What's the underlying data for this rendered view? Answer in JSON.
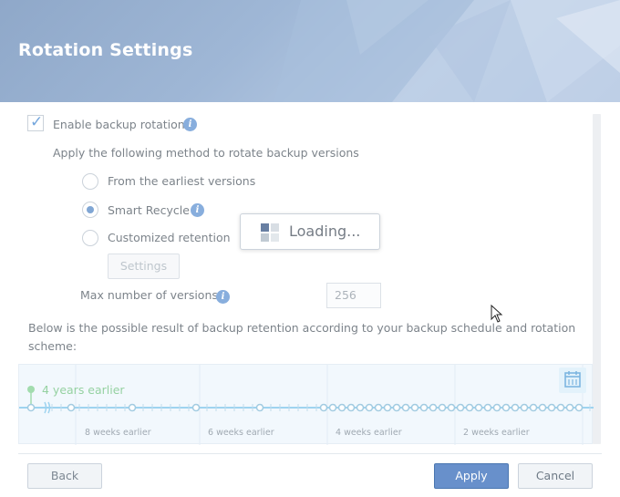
{
  "header": {
    "title": "Rotation Settings"
  },
  "rotation": {
    "enable_label": "Enable backup rotation",
    "enable_checked": true,
    "method_caption": "Apply the following method to rotate backup versions",
    "options": [
      {
        "label": "From the earliest versions",
        "checked": false
      },
      {
        "label": "Smart Recycle",
        "checked": true
      },
      {
        "label": "Customized retention",
        "checked": false
      }
    ],
    "settings_button": "Settings",
    "max_versions_label": "Max number of versions",
    "max_versions_value": "256"
  },
  "loading": {
    "text": "Loading..."
  },
  "result": {
    "caption_line1": "Below is the possible result of backup retention according to your backup schedule and rotation",
    "caption_line2": "scheme:"
  },
  "timeline": {
    "start_label": "4 years earlier",
    "tick_labels": [
      "8 weeks earlier",
      "6 weeks earlier",
      "4 weeks earlier",
      "2 weeks earlier"
    ]
  },
  "footer": {
    "back": "Back",
    "apply": "Apply",
    "cancel": "Cancel"
  },
  "colors": {
    "accent": "#4f84c4",
    "timeline_green": "#7fcf8f",
    "timeline_line": "#79c3ea",
    "apply_button": "#6890cb"
  }
}
